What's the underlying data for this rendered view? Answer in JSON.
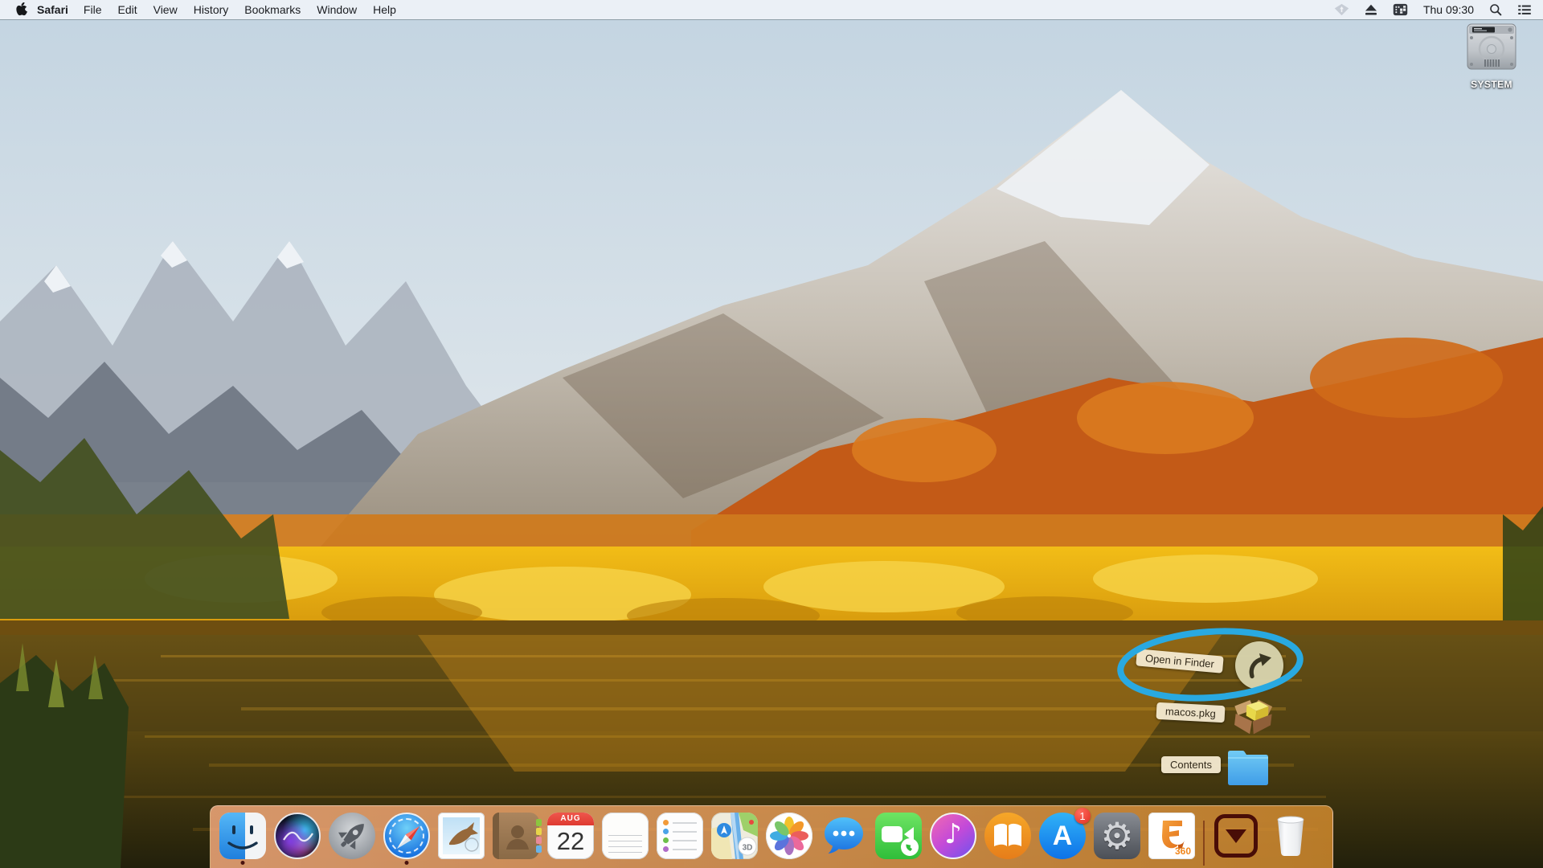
{
  "menu_bar": {
    "app_name": "Safari",
    "menus": [
      "File",
      "Edit",
      "View",
      "History",
      "Bookmarks",
      "Window",
      "Help"
    ],
    "clock": "Thu 09:30",
    "status_icons": [
      "diamond-sync-icon",
      "eject-icon",
      "input-grid-icon",
      "spotlight-icon",
      "notification-list-icon"
    ]
  },
  "desktop": {
    "volume_label": "SYSTEM"
  },
  "stack_fan": {
    "items": [
      {
        "label": "Open in Finder",
        "icon": "curved-arrow-button"
      },
      {
        "label": "macos.pkg",
        "icon": "package-icon"
      },
      {
        "label": "Contents",
        "icon": "blue-folder-icon"
      }
    ],
    "annotation": {
      "shape": "ellipse",
      "color": "#29a9e1"
    }
  },
  "dock": {
    "items": [
      "finder",
      "siri",
      "launchpad",
      "safari",
      "mail",
      "contacts",
      "calendar",
      "notes",
      "reminders",
      "maps",
      "photos",
      "messages",
      "facetime",
      "itunes",
      "books",
      "app-store",
      "system-preferences",
      "fusion-360",
      "divider",
      "downloads-stack",
      "trash"
    ],
    "running_apps": [
      "finder",
      "safari"
    ],
    "app_store_badge": "1",
    "calendar_month": "AUG",
    "calendar_day": "22",
    "maps_badge": "3D",
    "fusion_label": "360"
  },
  "colors": {
    "annotation_cyan": "#29a9e1",
    "menu_bar_bg": "#edf1f7",
    "dock_tint": "#e8a062",
    "stack_maroon": "#490d07"
  }
}
